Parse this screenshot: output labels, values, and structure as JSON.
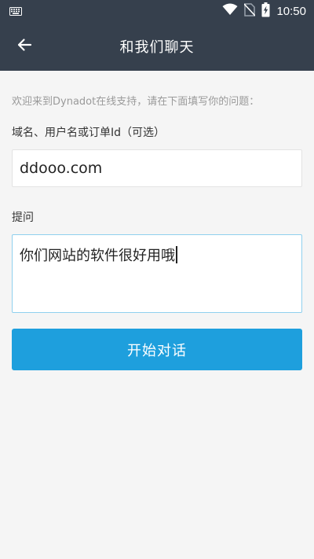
{
  "status_bar": {
    "time": "10:50",
    "icons": [
      "keyboard-icon",
      "wifi-icon",
      "no-sim-icon",
      "battery-charging-icon"
    ]
  },
  "app_bar": {
    "title": "和我们聊天",
    "back_icon": "arrow-left-icon"
  },
  "form": {
    "intro": "欢迎来到Dynadot在线支持，请在下面填写你的问题：",
    "domain_label": "域名、用户名或订单Id（可选）",
    "domain_value": "ddooo.com",
    "question_label": "提问",
    "question_value": "你们网站的软件很好用哦",
    "submit_label": "开始对话"
  },
  "colors": {
    "header": "#36404d",
    "background": "#f5f5f5",
    "accent": "#1e9fdd",
    "focus_border": "#8fd0ee"
  }
}
